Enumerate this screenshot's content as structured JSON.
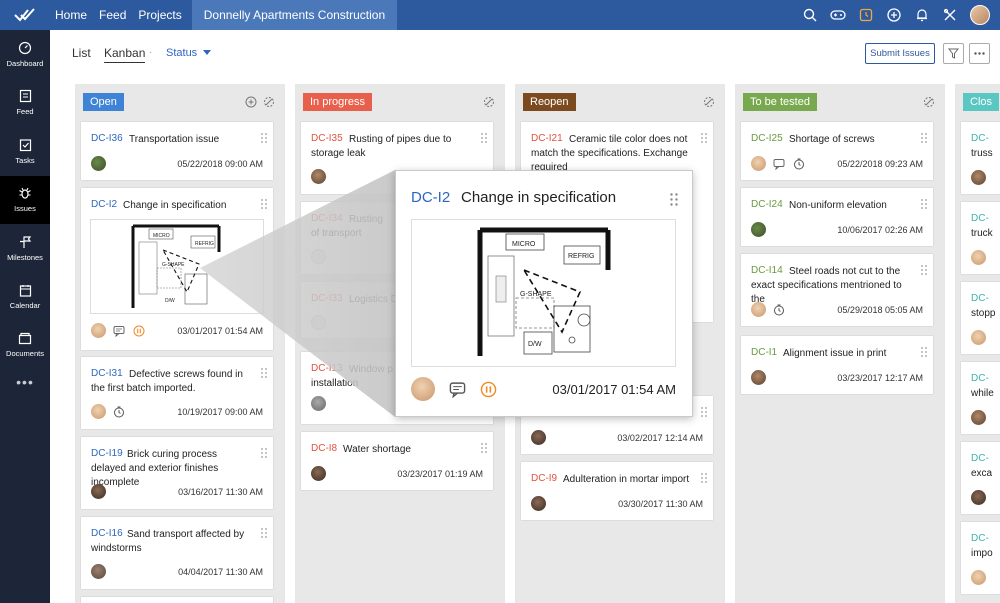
{
  "topbar": {
    "nav": [
      "Home",
      "Feed",
      "Projects"
    ],
    "project": "Donnelly Apartments Construction",
    "icons": [
      "search-icon",
      "gamepad-icon",
      "timer-icon",
      "add-icon",
      "bell-icon",
      "tools-icon"
    ]
  },
  "sidebar": {
    "items": [
      {
        "label": "Dashboard",
        "icon": "dashboard-icon"
      },
      {
        "label": "Feed",
        "icon": "feed-icon"
      },
      {
        "label": "Tasks",
        "icon": "tasks-icon"
      },
      {
        "label": "Issues",
        "icon": "bug-icon",
        "active": true
      },
      {
        "label": "Milestones",
        "icon": "milestone-icon"
      },
      {
        "label": "Calendar",
        "icon": "calendar-icon"
      },
      {
        "label": "Documents",
        "icon": "documents-icon"
      }
    ],
    "more": "•••"
  },
  "header": {
    "list_tab": "List",
    "kanban_tab": "Kanban",
    "separator": "·",
    "status_label": "Status",
    "submit_label": "Submit Issues"
  },
  "colors": {
    "open": "#3f83d6",
    "in_progress": "#e8604c",
    "reopen": "#7b4a1f",
    "to_be_tested": "#78a94f",
    "closed": "#5bc7c2"
  },
  "columns": [
    {
      "title": "Open",
      "cards": [
        {
          "id": "DC-I36",
          "title": "Transportation issue",
          "date": "05/22/2018 09:00 AM"
        },
        {
          "id": "DC-I2",
          "title": "Change in specification",
          "date": "03/01/2017 01:54 AM"
        },
        {
          "id": "DC-I31",
          "title": "Defective screws found in the first batch imported.",
          "date": "10/19/2017 09:00 AM"
        },
        {
          "id": "DC-I19",
          "title": "Brick curing process delayed and exterior finishes incomplete",
          "date": "03/16/2017 11:30 AM"
        },
        {
          "id": "DC-I16",
          "title": "Sand transport affected by windstorms",
          "date": "04/04/2017 11:30 AM"
        }
      ]
    },
    {
      "title": "In progress",
      "cards": [
        {
          "id": "DC-I35",
          "title": "Rusting of pipes due to storage leak",
          "date": ""
        },
        {
          "id": "DC-I34",
          "title": "Rusting of transport",
          "date": ""
        },
        {
          "id": "DC-I33",
          "title": "Logistics D",
          "date": ""
        },
        {
          "id": "DC-I13",
          "title": "Window p installation",
          "date": ""
        },
        {
          "id": "DC-I8",
          "title": "Water shortage",
          "date": "03/23/2017 01:19 AM"
        }
      ]
    },
    {
      "title": "Reopen",
      "cards": [
        {
          "id": "DC-I21",
          "title": "Ceramic tile color does not match the specifications. Exchange required",
          "date": ""
        },
        {
          "id": "",
          "title": "",
          "date": "03/02/2017 12:14 AM"
        },
        {
          "id": "DC-I9",
          "title": "Adulteration in mortar import",
          "date": "03/30/2017 11:30 AM"
        }
      ]
    },
    {
      "title": "To be tested",
      "cards": [
        {
          "id": "DC-I25",
          "title": "Shortage of screws",
          "date": "05/22/2018 09:23 AM"
        },
        {
          "id": "DC-I24",
          "title": "Non-uniform elevation",
          "date": "10/06/2017 02:26 AM"
        },
        {
          "id": "DC-I14",
          "title": "Steel roads not cut to the exact specifications mentrioned to the",
          "date": "05/29/2018 05:05 AM"
        },
        {
          "id": "DC-I1",
          "title": "Alignment issue in print",
          "date": "03/23/2017 12:17 AM"
        }
      ]
    },
    {
      "title": "Clos",
      "cards": [
        {
          "id": "DC-",
          "title": "truss"
        },
        {
          "id": "DC-",
          "title": "truck"
        },
        {
          "id": "DC-",
          "title": "stopp"
        },
        {
          "id": "DC-",
          "title": "while"
        },
        {
          "id": "DC-",
          "title": "exca"
        },
        {
          "id": "DC-",
          "title": "impo"
        }
      ]
    }
  ],
  "floorplan": {
    "labels": [
      "MICRO",
      "REFRIG",
      "G-SHAPE",
      "D/W"
    ]
  },
  "zoom": {
    "id": "DC-I2",
    "title": "Change in specification",
    "date": "03/01/2017 01:54 AM"
  }
}
